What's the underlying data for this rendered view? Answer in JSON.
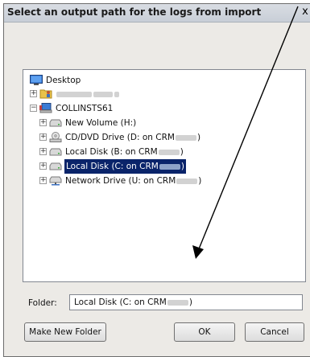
{
  "dialog": {
    "title": "Select an output path for the logs from import",
    "close_glyph": "x"
  },
  "tree": {
    "nodes": [
      {
        "label": "Desktop",
        "icon": "desktop-icon"
      },
      {
        "label": "Karma, Bruer S",
        "icon": "user-folder-icon",
        "expand": "+"
      },
      {
        "label": "COLLINSTS61",
        "icon": "computer-icon",
        "expand": "−"
      },
      {
        "label": "New Volume (H:)",
        "icon": "drive-icon",
        "expand": "+"
      },
      {
        "prefix": "CD/DVD Drive (D: on CRM",
        "suffix": ")",
        "icon": "cd-drive-icon",
        "expand": "+"
      },
      {
        "prefix": "Local Disk (B: on CRM",
        "suffix": ")",
        "icon": "drive-icon",
        "expand": "+"
      },
      {
        "prefix": "Local Disk (C: on CRM",
        "suffix": ")",
        "icon": "drive-icon",
        "expand": "+",
        "selected": true
      },
      {
        "prefix": "Network Drive (U: on CRM",
        "suffix": ")",
        "icon": "network-drive-icon",
        "expand": "+"
      }
    ]
  },
  "folder": {
    "label": "Folder:",
    "value_prefix": "Local Disk (C: on CRM",
    "value_suffix": ")"
  },
  "buttons": {
    "make_new_folder": "Make New Folder",
    "ok": "OK",
    "cancel": "Cancel"
  },
  "colors": {
    "selection": "#0a246a",
    "arrow": "#000000"
  }
}
